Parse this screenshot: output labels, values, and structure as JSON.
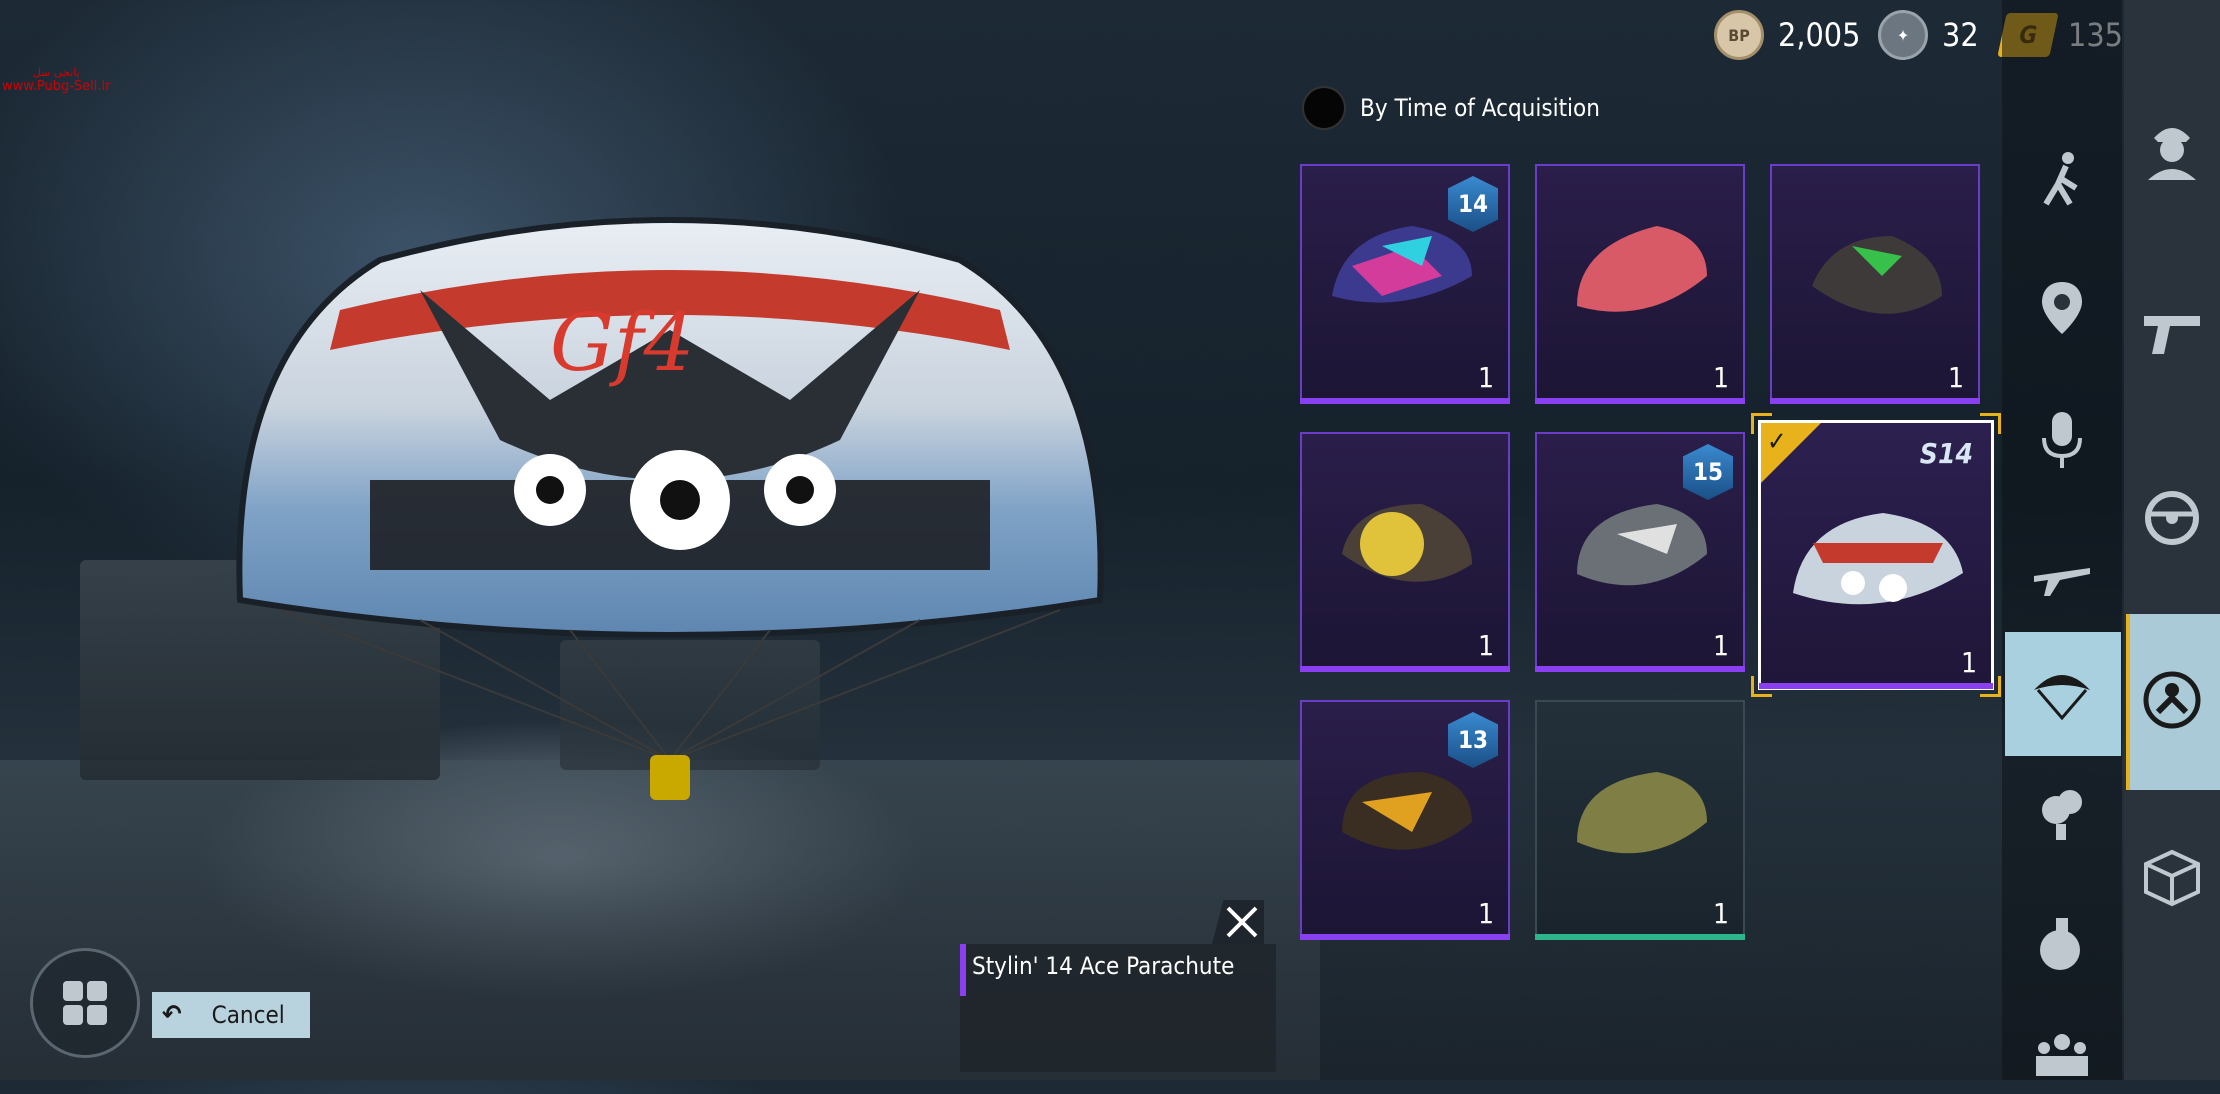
{
  "watermark": {
    "line1": "پابجی سل",
    "line2": "www.Pubg-Sell.ir"
  },
  "currency": {
    "bp": {
      "icon": "bp-icon",
      "label": "BP",
      "value": "2,005"
    },
    "ag": {
      "icon": "ag-icon",
      "value": "32"
    },
    "g": {
      "icon": "g-coin-icon",
      "label": "G",
      "value": "135"
    }
  },
  "sort": {
    "label": "By Time of Acquisition"
  },
  "inventory": [
    {
      "badge": "14",
      "qty": "1",
      "rarity": "purple"
    },
    {
      "badge": "",
      "qty": "1",
      "rarity": "purple"
    },
    {
      "badge": "",
      "qty": "1",
      "rarity": "purple"
    },
    {
      "badge": "",
      "qty": "1",
      "rarity": "purple"
    },
    {
      "badge": "15",
      "qty": "1",
      "rarity": "purple"
    },
    {
      "badge": "S14",
      "qty": "1",
      "rarity": "purple",
      "selected": true
    },
    {
      "badge": "13",
      "qty": "1",
      "rarity": "purple"
    },
    {
      "badge": "",
      "qty": "1",
      "rarity": "green"
    }
  ],
  "selected_item": {
    "name": "Stylin' 14 Ace Parachute"
  },
  "buttons": {
    "cancel": "Cancel"
  },
  "rail_categories": [
    "emote-icon",
    "location-icon",
    "voice-icon",
    "plane-icon",
    "parachute-icon",
    "smoke-icon",
    "grenade-icon",
    "team-icon"
  ],
  "rail2_categories": [
    "outfit-icon",
    "weapon-icon",
    "vehicle-icon",
    "character-icon",
    "crate-icon"
  ],
  "colors": {
    "rarity_purple": "#8a3ff0",
    "rarity_green": "#2fb58a",
    "accent_gold": "#e8b21c",
    "active_tab": "#a9d0df"
  }
}
